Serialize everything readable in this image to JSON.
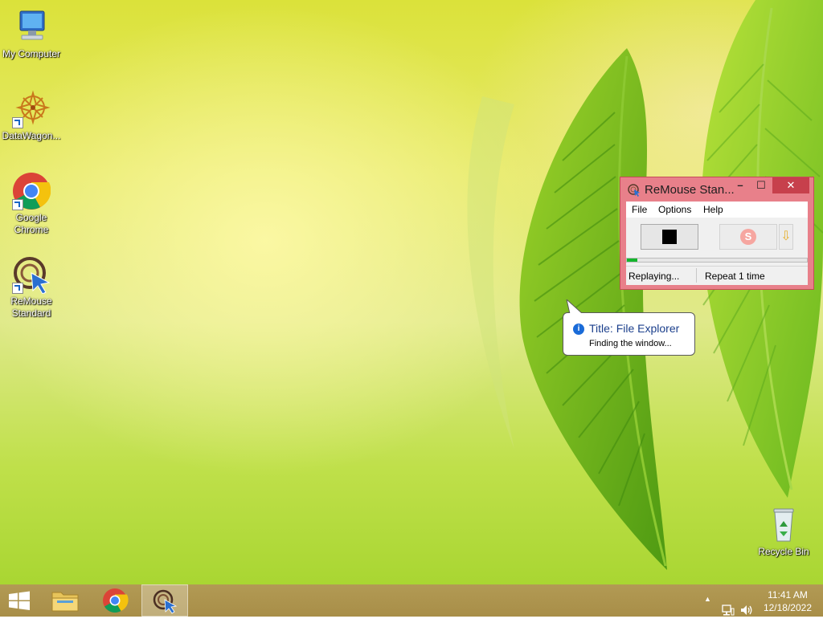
{
  "desktop": {
    "icons": [
      {
        "label": "My Computer"
      },
      {
        "label": "DataWagon..."
      },
      {
        "label": "Google\nChrome"
      },
      {
        "label": "ReMouse\nStandard"
      },
      {
        "label": "Recycle Bin"
      }
    ]
  },
  "remouse_window": {
    "title": "ReMouse Stan...",
    "controls": {
      "minimize": "–",
      "maximize": "☐",
      "close": "✕"
    },
    "menu": [
      "File",
      "Options",
      "Help"
    ],
    "record_glyph": "S",
    "dropdown_glyph": "⇩",
    "progress_fraction": 0.06,
    "status": {
      "left": "Replaying...",
      "right": "Repeat 1 time"
    }
  },
  "balloon": {
    "title": "Title: File Explorer",
    "message": "Finding the window...",
    "icon": "info-icon"
  },
  "taskbar": {
    "items": [
      "start-button",
      "file-explorer",
      "google-chrome",
      "remouse"
    ],
    "active": "remouse",
    "clock": {
      "time": "11:41 AM",
      "date": "12/18/2022"
    },
    "tray_icons": [
      "chevron-up-icon",
      "network-icon",
      "volume-icon"
    ]
  },
  "colors": {
    "window_frame": "#e8808a",
    "close_button": "#c7404c",
    "progress": "#14b52c",
    "taskbar": "#ad9350"
  }
}
